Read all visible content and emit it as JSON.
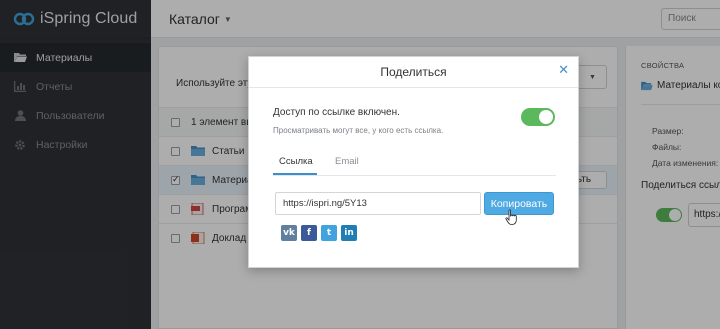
{
  "app": {
    "brand": "iSpring Cloud"
  },
  "sidebar": {
    "items": [
      {
        "label": "Материалы",
        "icon": "folder-open-icon",
        "active": true
      },
      {
        "label": "Отчеты",
        "icon": "bar-chart-icon",
        "active": false
      },
      {
        "label": "Пользователи",
        "icon": "user-icon",
        "active": false
      },
      {
        "label": "Настройки",
        "icon": "gear-icon",
        "active": false
      }
    ]
  },
  "header": {
    "title": "Каталог",
    "search_placeholder": "Поиск"
  },
  "content": {
    "hint": "Используйте эту",
    "dropdown_label": "ь",
    "selection_text": "1 элемент вы",
    "rows": [
      {
        "name": "Статьи",
        "icon": "folder-icon",
        "checked": false
      },
      {
        "name": "Материа",
        "icon": "folder-icon",
        "checked": true,
        "button": "льть"
      },
      {
        "name": "Програм",
        "icon": "pdf-icon",
        "checked": false
      },
      {
        "name": "Доклад о",
        "icon": "ppt-icon",
        "checked": false
      }
    ]
  },
  "properties": {
    "title": "СВОЙСТВА",
    "folder_name": "Материалы ко",
    "size_label": "Размер:",
    "files_label": "Файлы:",
    "modified_label": "Дата изменения:",
    "share_label": "Поделиться ссылк",
    "link_value": "https:/"
  },
  "modal": {
    "title": "Поделиться",
    "access_text": "Доступ по ссылке включен.",
    "access_sub": "Просматривать могут все, у кого есть ссылка.",
    "access_enabled": true,
    "tabs": [
      "Ссылка",
      "Email"
    ],
    "active_tab": "Ссылка",
    "link": "https://ispri.ng/5Y13",
    "copy_label": "Копировать",
    "socials": [
      {
        "name": "vk-icon",
        "glyph": "vk"
      },
      {
        "name": "facebook-icon",
        "glyph": "f"
      },
      {
        "name": "twitter-icon",
        "glyph": "t"
      },
      {
        "name": "linkedin-icon",
        "glyph": "in"
      }
    ]
  },
  "colors": {
    "sidebar_bg": "#2f3237",
    "accent": "#4fa9e3",
    "toggle_on": "#5cb85c"
  }
}
